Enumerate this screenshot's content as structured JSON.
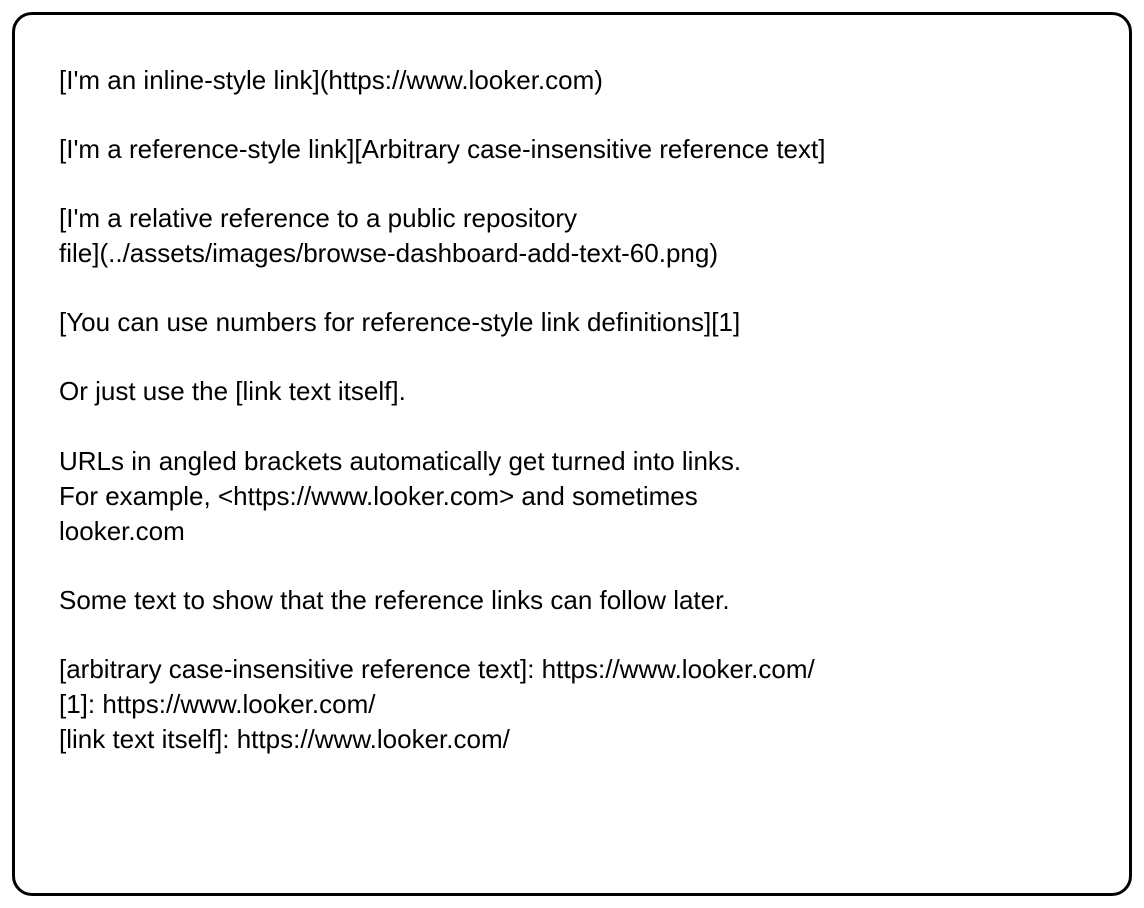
{
  "lines": {
    "l1": "[I'm an inline-style link](https://www.looker.com)",
    "l2": "[I'm a reference-style link][Arbitrary case-insensitive reference text]",
    "l3a": "[I'm a relative reference to a public repository",
    "l3b": "file](../assets/images/browse-dashboard-add-text-60.png)",
    "l4": "[You can use numbers for reference-style link definitions][1]",
    "l5": "Or just use the [link text itself].",
    "l6a": "URLs in angled brackets automatically get turned into links.",
    "l6b": "For example, <https://www.looker.com> and sometimes",
    "l6c": "looker.com",
    "l7": "Some text to show that the reference links can follow later.",
    "l8a": "[arbitrary case-insensitive reference text]: https://www.looker.com/",
    "l8b": "[1]: https://www.looker.com/",
    "l8c": "[link text itself]: https://www.looker.com/"
  }
}
